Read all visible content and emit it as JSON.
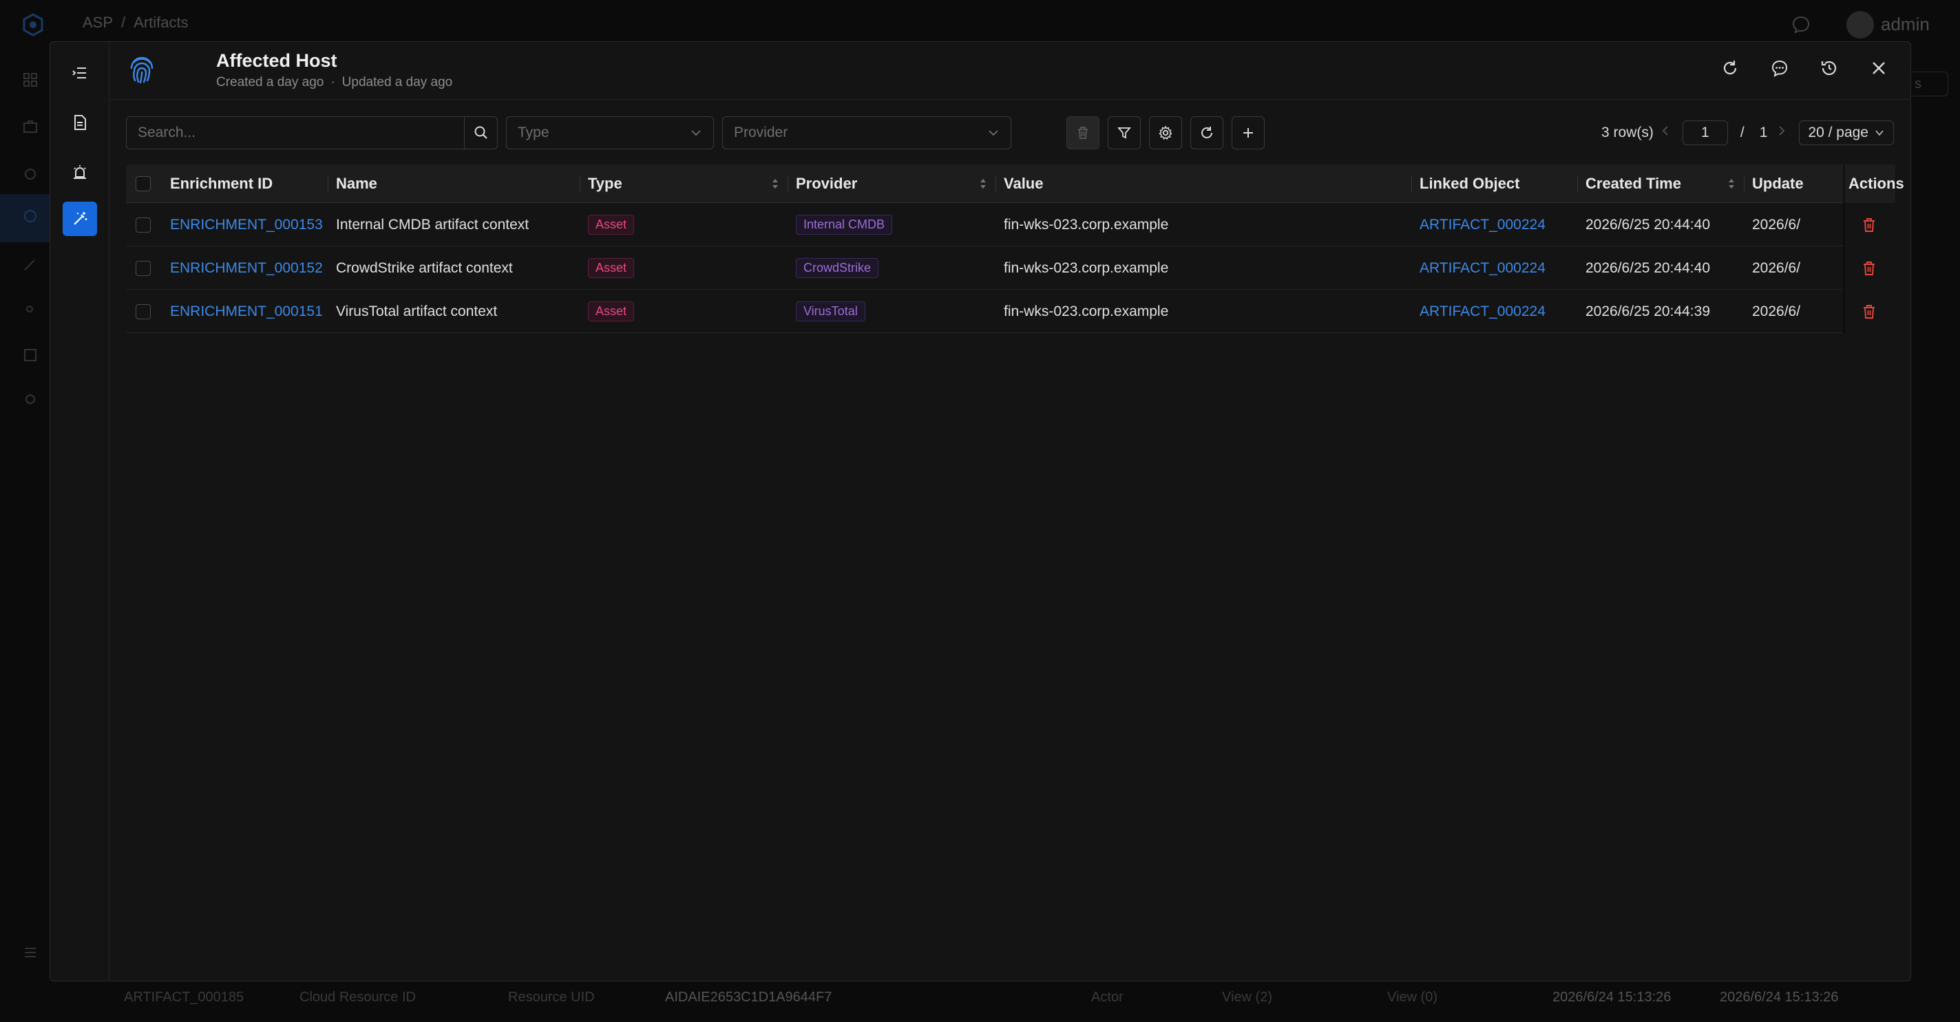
{
  "background": {
    "breadcrumb": [
      "ASP",
      "/",
      "Artifacts"
    ],
    "user": "admin",
    "right_select_text": "s",
    "bottom_row": [
      "ARTIFACT_000185",
      "Cloud Resource ID",
      "Resource UID",
      "AIDAIE2653C1D1A9644F7",
      "Actor",
      "View (2)",
      "View (0)",
      "2026/6/24 15:13:26",
      "2026/6/24 15:13:26"
    ]
  },
  "modal": {
    "title": "Affected Host",
    "created": "Created a day ago",
    "separator": "·",
    "updated": "Updated a day ago"
  },
  "toolbar": {
    "search_placeholder": "Search...",
    "type_placeholder": "Type",
    "provider_placeholder": "Provider"
  },
  "pager": {
    "rows": "3 row(s)",
    "current_page": "1",
    "slash": "/",
    "total_pages": "1",
    "page_size": "20 / page"
  },
  "table": {
    "columns": {
      "enrichment_id": "Enrichment ID",
      "name": "Name",
      "type": "Type",
      "provider": "Provider",
      "value": "Value",
      "linked_object": "Linked Object",
      "created_time": "Created Time",
      "updated": "Update",
      "actions": "Actions"
    },
    "rows": [
      {
        "id": "ENRICHMENT_000153",
        "name": "Internal CMDB artifact context",
        "type": "Asset",
        "provider": "Internal CMDB",
        "value": "fin-wks-023.corp.example",
        "linked": "ARTIFACT_000224",
        "created": "2026/6/25 20:44:40",
        "updated": "2026/6/"
      },
      {
        "id": "ENRICHMENT_000152",
        "name": "CrowdStrike artifact context",
        "type": "Asset",
        "provider": "CrowdStrike",
        "value": "fin-wks-023.corp.example",
        "linked": "ARTIFACT_000224",
        "created": "2026/6/25 20:44:40",
        "updated": "2026/6/"
      },
      {
        "id": "ENRICHMENT_000151",
        "name": "VirusTotal artifact context",
        "type": "Asset",
        "provider": "VirusTotal",
        "value": "fin-wks-023.corp.example",
        "linked": "ARTIFACT_000224",
        "created": "2026/6/25 20:44:39",
        "updated": "2026/6/"
      }
    ]
  },
  "colors": {
    "accent": "#1668dc",
    "link": "#3c89e8",
    "delete": "#e8453c",
    "tag_asset": "#e84a7c",
    "tag_provider": "#9b6fd6"
  }
}
